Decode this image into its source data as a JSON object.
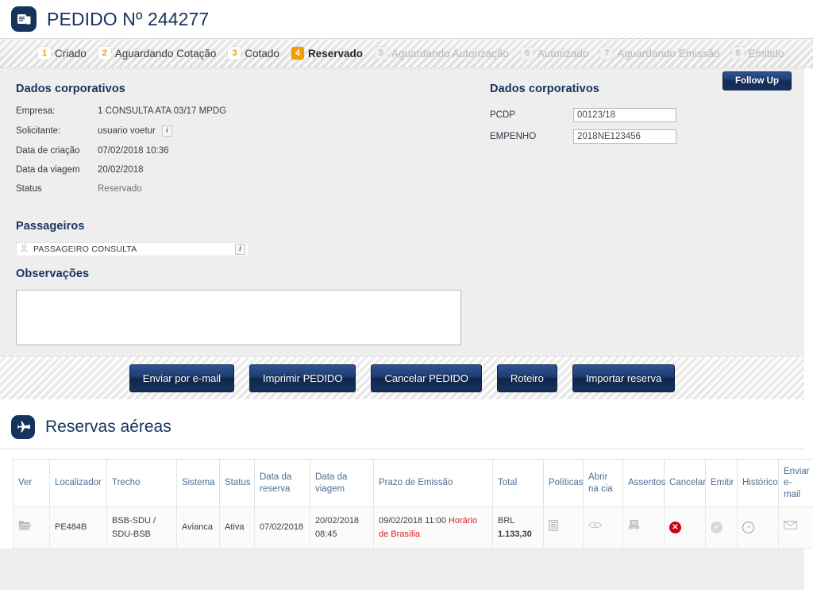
{
  "header": {
    "logo_icon": "document-pages-icon",
    "title": "PEDIDO Nº 244277"
  },
  "stepper": {
    "steps": [
      {
        "num": "1",
        "label": "Criado",
        "state": "done"
      },
      {
        "num": "2",
        "label": "Aguardando Cotação",
        "state": "done"
      },
      {
        "num": "3",
        "label": "Cotado",
        "state": "done"
      },
      {
        "num": "4",
        "label": "Reservado",
        "state": "active"
      },
      {
        "num": "5",
        "label": "Aguardando Autorização",
        "state": "pending"
      },
      {
        "num": "6",
        "label": "Autorizado",
        "state": "pending"
      },
      {
        "num": "7",
        "label": "Aguardando Emissão",
        "state": "pending"
      },
      {
        "num": "8",
        "label": "Emitido",
        "state": "pending"
      }
    ]
  },
  "corporate_left": {
    "title": "Dados corporativos",
    "rows": [
      {
        "key": "Empresa:",
        "value": "1 CONSULTA ATA 03/17 MPDG",
        "info": false
      },
      {
        "key": "Solicitante:",
        "value": "usuario voetur",
        "info": true
      },
      {
        "key": "Data de criação",
        "value": "07/02/2018 10:36",
        "info": false
      },
      {
        "key": "Data da viagem",
        "value": "20/02/2018",
        "info": false
      },
      {
        "key": "Status",
        "value": "Reservado",
        "info": false
      }
    ]
  },
  "corporate_right": {
    "title": "Dados corporativos",
    "follow_up_label": "Follow Up",
    "fields": [
      {
        "label": "PCDP",
        "value": "00123/18",
        "placeholder": ""
      },
      {
        "label": "EMPENHO",
        "value": "2018NE123456",
        "placeholder": ""
      }
    ]
  },
  "passengers": {
    "title": "Passageiros",
    "items": [
      {
        "name": "PASSAGEIRO CONSULTA",
        "person_icon": "person-icon",
        "info_icon": "info-icon"
      }
    ]
  },
  "observations": {
    "title": "Observações",
    "value": "",
    "placeholder": ""
  },
  "actions": {
    "buttons": [
      {
        "label": "Enviar por e-mail"
      },
      {
        "label": "Imprimir PEDIDO"
      },
      {
        "label": "Cancelar PEDIDO"
      },
      {
        "label": "Roteiro"
      },
      {
        "label": "Importar reserva"
      }
    ]
  },
  "reservations": {
    "logo_icon": "airplane-icon",
    "title": "Reservas aéreas",
    "columns": [
      "Ver",
      "Localizador",
      "Trecho",
      "Sistema",
      "Status",
      "Data da reserva",
      "Data da viagem",
      "Prazo de Emissão",
      "Total",
      "Políticas",
      "Abrir na cia",
      "Assentos",
      "Cancelar",
      "Emitir",
      "Histórico",
      "Enviar e-mail"
    ],
    "rows": [
      {
        "ver_icon": "folder-open-icon",
        "localizador": "PE484B",
        "trecho": "BSB-SDU / SDU-BSB",
        "sistema": "Avianca",
        "status": "Ativa",
        "data_reserva": "07/02/2018",
        "data_viagem": "20/02/2018 08:45",
        "prazo_emissao_date": "09/02/2018 11:00 ",
        "prazo_emissao_note": "Horário de Brasília",
        "total_currency": "BRL",
        "total_value": "1.133,30",
        "politicas_icon": "list-document-icon",
        "abrir_na_cia_icon": "eye-icon",
        "assentos_icon": "seat-icon",
        "cancelar_icon": "cancel-circle-icon",
        "emitir_icon": "check-circle-disabled-icon",
        "historico_icon": "clock-icon",
        "enviar_email_icon": "envelope-icon"
      }
    ]
  },
  "colors": {
    "brand_navy": "#16335e",
    "accent_orange": "#f59b00",
    "danger_red": "#d00016",
    "deadline_red": "#e02020",
    "table_header_blue": "#4d6e92",
    "panel_gray": "#eeeeee"
  }
}
